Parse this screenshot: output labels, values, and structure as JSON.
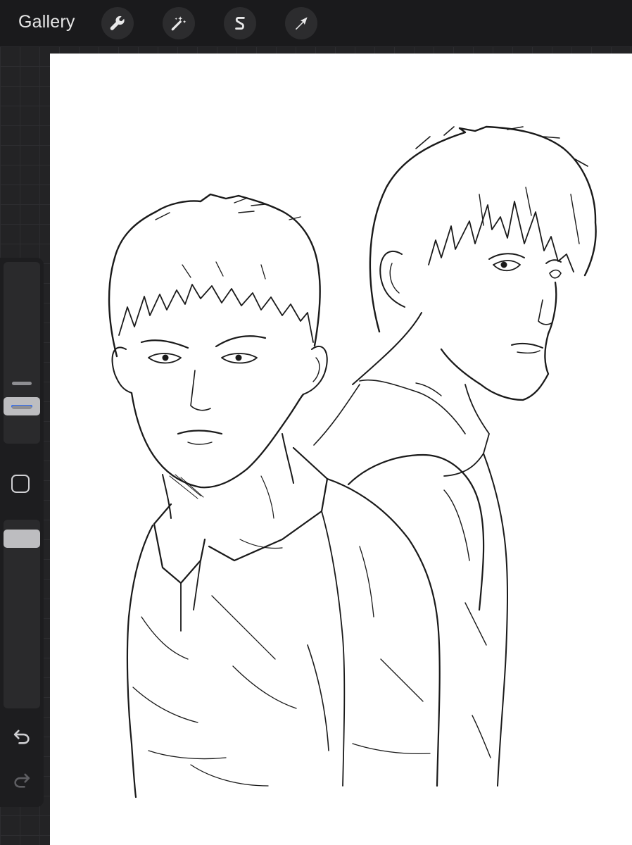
{
  "toolbar": {
    "gallery_label": "Gallery",
    "tools": [
      {
        "name": "actions",
        "icon": "wrench-icon"
      },
      {
        "name": "adjustments",
        "icon": "magic-wand-icon"
      },
      {
        "name": "selection",
        "icon": "selection-s-icon"
      },
      {
        "name": "transform",
        "icon": "arrow-cursor-icon"
      }
    ]
  },
  "sidebar": {
    "brush_size_slider": {
      "icon": "slider-thumb"
    },
    "modify_button": {
      "icon": "square-icon"
    },
    "opacity_slider": {
      "icon": "slider-thumb"
    },
    "undo": {
      "icon": "undo-arrow-icon"
    },
    "redo": {
      "icon": "redo-arrow-icon"
    }
  },
  "colors": {
    "toolbar_bg": "#1a1a1c",
    "canvas_bg": "#232325",
    "paper": "#ffffff",
    "accent": "#2f6cf4",
    "ink": "#1a1a1a"
  }
}
